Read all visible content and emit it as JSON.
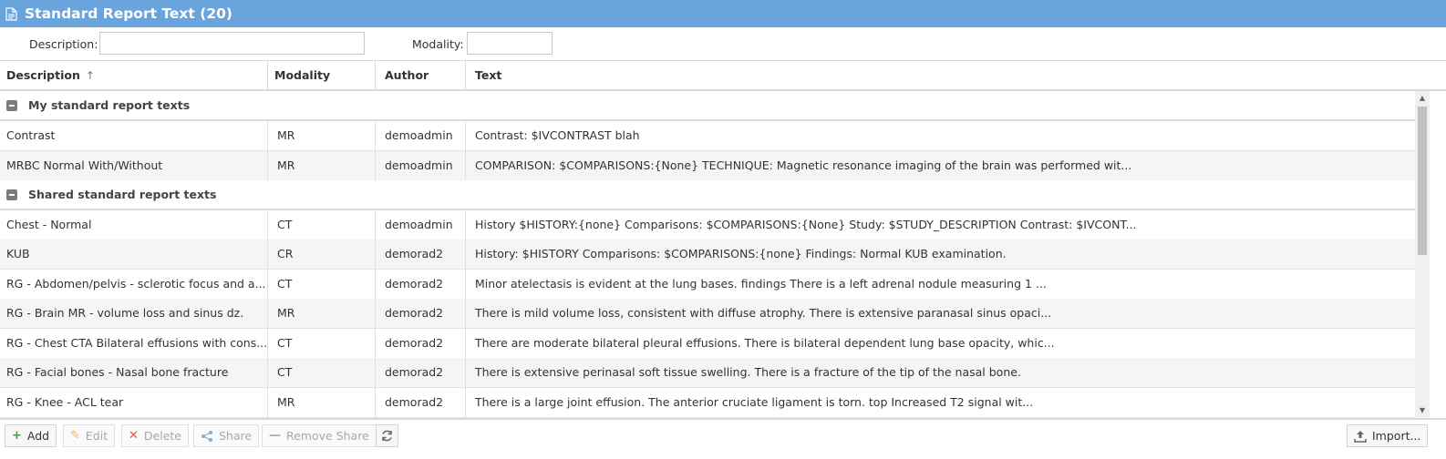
{
  "title": "Standard Report Text (20)",
  "filters": {
    "description_label": "Description:",
    "description_value": "",
    "modality_label": "Modality:",
    "modality_value": ""
  },
  "columns": {
    "description": "Description",
    "modality": "Modality",
    "author": "Author",
    "text": "Text"
  },
  "groups": [
    {
      "label": "My standard report texts",
      "rows": [
        {
          "description": "Contrast",
          "modality": "MR",
          "author": "demoadmin",
          "text": "Contrast: $IVCONTRAST blah"
        },
        {
          "description": "MRBC Normal With/Without",
          "modality": "MR",
          "author": "demoadmin",
          "text": "COMPARISON: $COMPARISONS:{None} TECHNIQUE: Magnetic resonance imaging of the brain was performed wit..."
        }
      ]
    },
    {
      "label": "Shared standard report texts",
      "rows": [
        {
          "description": "Chest - Normal",
          "modality": "CT",
          "author": "demoadmin",
          "text": "History $HISTORY:{none} Comparisons: $COMPARISONS:{None} Study: $STUDY_DESCRIPTION Contrast: $IVCONT..."
        },
        {
          "description": "KUB",
          "modality": "CR",
          "author": "demorad2",
          "text": "History: $HISTORY Comparisons: $COMPARISONS:{none} Findings: Normal KUB examination."
        },
        {
          "description": "RG - Abdomen/pelvis - sclerotic focus and a...",
          "modality": "CT",
          "author": "demorad2",
          "text": "Minor atelectasis is evident at the lung bases. findings There is a left adrenal nodule measuring 1 ..."
        },
        {
          "description": "RG - Brain MR - volume loss and sinus dz.",
          "modality": "MR",
          "author": "demorad2",
          "text": "There is mild volume loss, consistent with diffuse atrophy. There is extensive paranasal sinus opaci..."
        },
        {
          "description": "RG - Chest CTA Bilateral effusions with cons...",
          "modality": "CT",
          "author": "demorad2",
          "text": "There are moderate bilateral pleural effusions. There is bilateral dependent lung base opacity, whic..."
        },
        {
          "description": "RG - Facial bones - Nasal bone fracture",
          "modality": "CT",
          "author": "demorad2",
          "text": "There is extensive perinasal soft tissue swelling. There is a fracture of the tip of the nasal bone."
        },
        {
          "description": "RG - Knee - ACL tear",
          "modality": "MR",
          "author": "demorad2",
          "text": "There is a large joint effusion. The anterior cruciate ligament is torn. top Increased T2 signal wit..."
        }
      ]
    }
  ],
  "toolbar": {
    "add": "Add",
    "edit": "Edit",
    "delete": "Delete",
    "share": "Share",
    "remove_share": "Remove Share",
    "import": "Import..."
  },
  "icons": {
    "title": "document-icon",
    "sort": "sort-ascending-icon",
    "refresh": "refresh-icon"
  },
  "colors": {
    "title_bar": "#6aa4dc",
    "alt_row": "#f5f5f5"
  }
}
